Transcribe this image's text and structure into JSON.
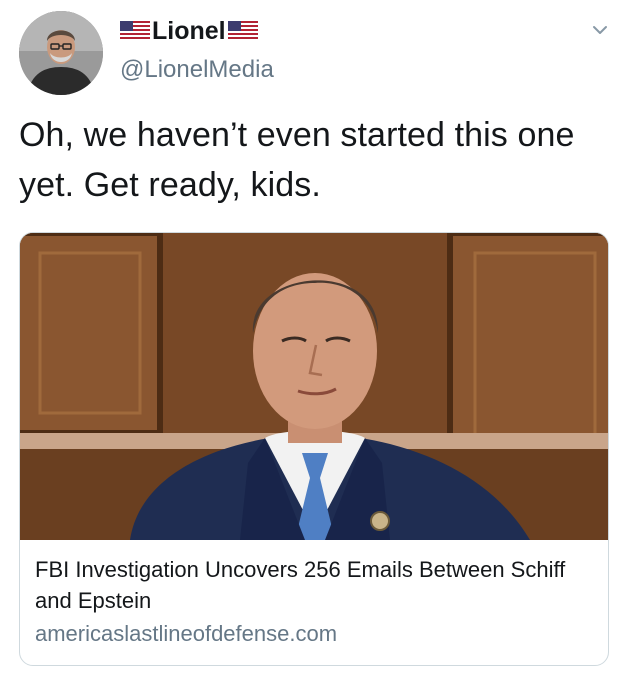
{
  "author": {
    "display_name": "Lionel",
    "handle": "@LionelMedia",
    "avatar_icon": "profile-photo",
    "name_flags": [
      "us-flag-icon",
      "us-flag-icon"
    ]
  },
  "tweet": {
    "text": "Oh, we haven’t even started this one yet. Get ready, kids."
  },
  "card": {
    "title": "FBI Investigation Uncovers 256 Emails Between Schiff and Epstein",
    "domain": "americaslastlineofdefense.com",
    "image_icon": "news-photo"
  },
  "colors": {
    "text": "#14171a",
    "secondary": "#657786",
    "card_border": "#cfd9de",
    "wood_panel": "#7a4a28",
    "suit": "#1f2d52",
    "tie": "#4f7fc4"
  }
}
